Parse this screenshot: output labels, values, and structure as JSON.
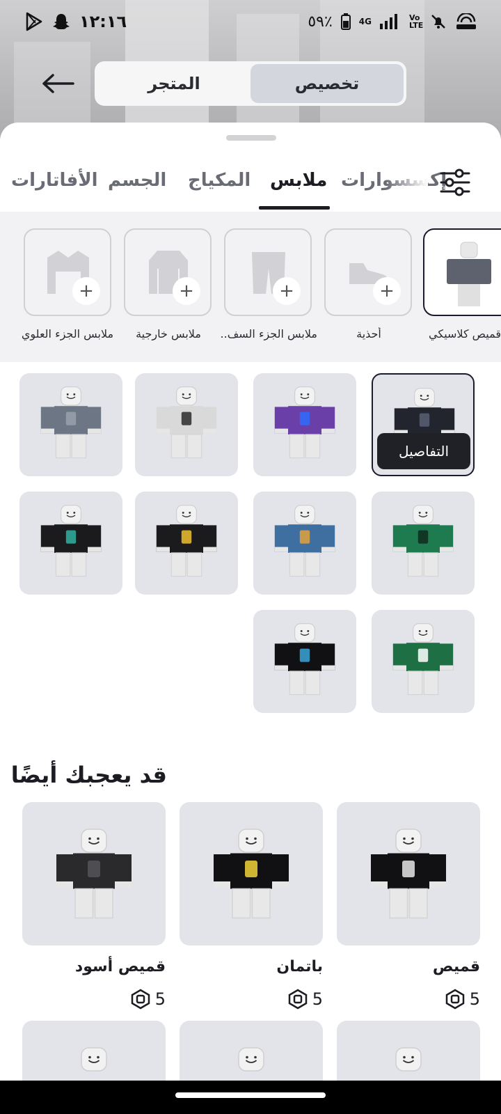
{
  "status_bar": {
    "time": "١٢:١٦",
    "battery": "٥٩٪",
    "network": "4G",
    "volte": "Vo LTE"
  },
  "header": {
    "segments": [
      {
        "label": "تخصيص",
        "active": true
      },
      {
        "label": "المتجر",
        "active": false
      }
    ]
  },
  "tabs": [
    {
      "label": "الأفاتارات",
      "active": false
    },
    {
      "label": "الجسم",
      "active": false
    },
    {
      "label": "المكياج",
      "active": false
    },
    {
      "label": "ملابس",
      "active": true
    },
    {
      "label": "إكسسوارات",
      "active": false
    }
  ],
  "categories": [
    {
      "label": "قميص كلاسيكي",
      "selected": true
    },
    {
      "label": "أحذية",
      "selected": false
    },
    {
      "label": "ملابس الجزء السف...",
      "selected": false
    },
    {
      "label": "ملابس خارجية",
      "selected": false
    },
    {
      "label": "ملابس الجزء العلوي",
      "selected": false
    }
  ],
  "grid": {
    "details_label": "التفاصيل",
    "items": [
      {
        "name": "jersey-11",
        "selected": true,
        "shirt": "#23252e",
        "accent": "#5b5f73"
      },
      {
        "name": "purple-vest",
        "selected": false,
        "shirt": "#6b3fa8",
        "accent": "#2d6cff"
      },
      {
        "name": "skeleton",
        "selected": false,
        "shirt": "#d9d9d9",
        "accent": "#2a2a2a"
      },
      {
        "name": "gray-hoodie",
        "selected": false,
        "shirt": "#6d7684",
        "accent": "#9aa1ad"
      },
      {
        "name": "checkered",
        "selected": false,
        "shirt": "#1e7a4f",
        "accent": "#0f2a1e"
      },
      {
        "name": "pizza-hoodie",
        "selected": false,
        "shirt": "#3f6fa0",
        "accent": "#e2a13d"
      },
      {
        "name": "rainbow-jacket",
        "selected": false,
        "shirt": "#1b1b1d",
        "accent": "#f0c030"
      },
      {
        "name": "leather-jacket",
        "selected": false,
        "shirt": "#1b1b1d",
        "accent": "#2fb0a0"
      },
      {
        "name": "green-jersey-8",
        "selected": false,
        "shirt": "#1f6f44",
        "accent": "#ffffff"
      },
      {
        "name": "black-blue",
        "selected": false,
        "shirt": "#111113",
        "accent": "#3aa4d8"
      }
    ]
  },
  "recommendations": {
    "title": "قد يعجبك أيضًا",
    "items": [
      {
        "name": "قميص",
        "price": "5",
        "shirt": "#111113",
        "accent": "#e6e6e6"
      },
      {
        "name": "باتمان",
        "price": "5",
        "shirt": "#111113",
        "accent": "#f2d23a"
      },
      {
        "name": "قميص أسود",
        "price": "5",
        "shirt": "#2a2a2c",
        "accent": "#555559"
      }
    ]
  }
}
